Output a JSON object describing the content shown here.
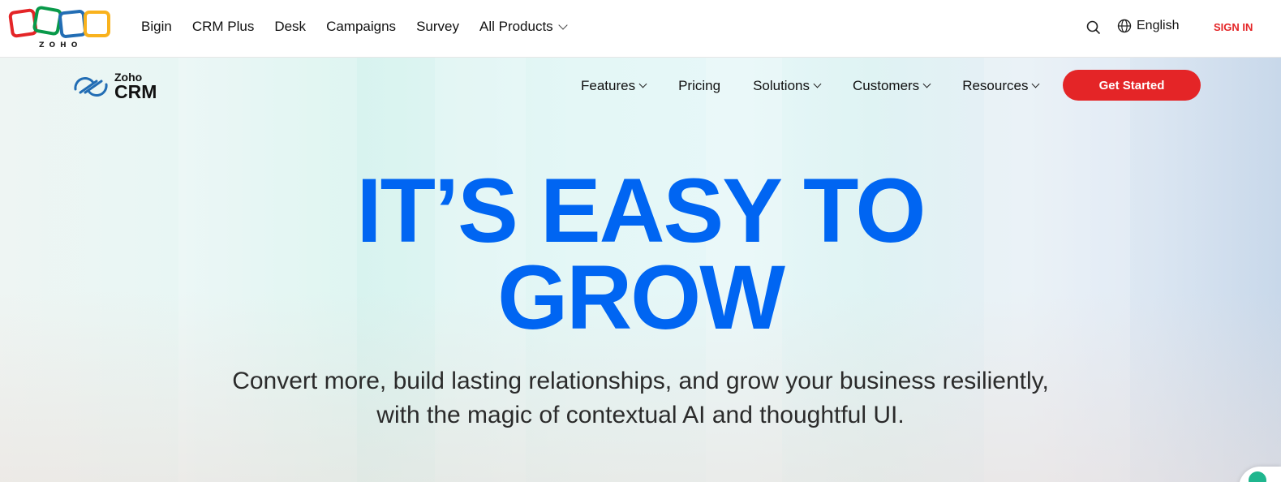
{
  "brand": {
    "wordmark": "ZOHO",
    "colors": {
      "red": "#e42527",
      "green": "#089949",
      "blue": "#226db4",
      "yellow": "#f9b21d"
    }
  },
  "topnav": {
    "items": [
      "Bigin",
      "CRM Plus",
      "Desk",
      "Campaigns",
      "Survey",
      "All Products"
    ],
    "search_icon": "search-icon",
    "language": "English",
    "signin": "SIGN IN"
  },
  "product": {
    "logo_top": "Zoho",
    "logo_bottom": "CRM",
    "nav": [
      "Features",
      "Pricing",
      "Solutions",
      "Customers",
      "Resources"
    ],
    "cta": "Get Started"
  },
  "hero": {
    "headline_line1": "IT’S EASY TO",
    "headline_line2": "GROW",
    "sub_line1": "Convert more, build lasting relationships, and grow your business resiliently,",
    "sub_line2": "with the magic of contextual AI and thoughtful UI.",
    "accent_color": "#0065f2"
  }
}
